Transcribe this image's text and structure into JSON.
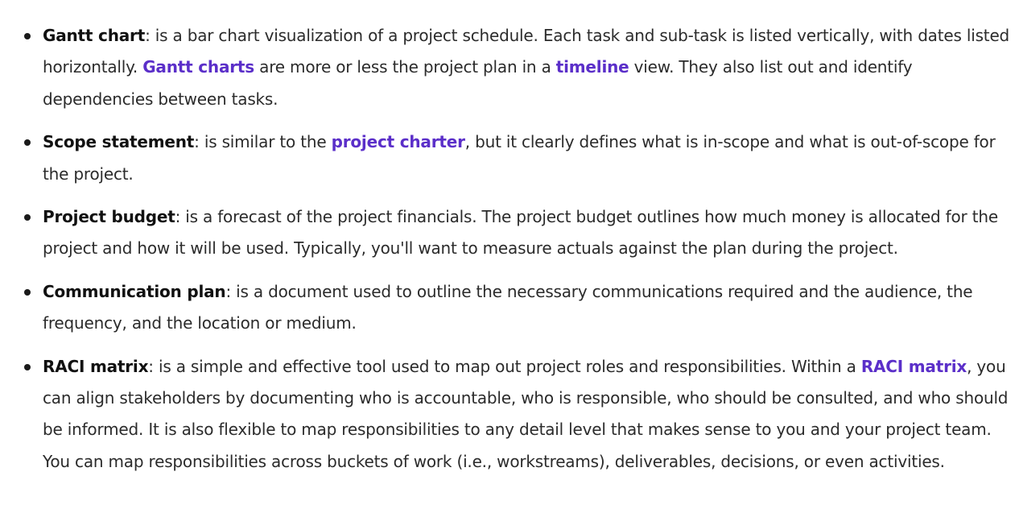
{
  "colors": {
    "text": "#2b2b2b",
    "term": "#111111",
    "link": "#5b2fc9"
  },
  "items": [
    {
      "term": "Gantt chart",
      "t1": ":  is a bar chart visualization of a project schedule. Each task and sub-task is listed vertically, with dates listed horizontally. ",
      "link1": "Gantt charts",
      "t2": " are more or less the project plan in a ",
      "link2": "timeline",
      "t3": " view. They also list out and identify dependencies between tasks."
    },
    {
      "term": "Scope statement",
      "t1": ": is similar to the ",
      "link1": "project charter",
      "t2": ", but it clearly defines what is in-scope and what is out-of-scope for the project."
    },
    {
      "term": "Project budget",
      "t1": ": is a forecast of the project financials. The project budget outlines how much money is allocated for the project and how it will be used. Typically, you'll want to measure actuals against the plan during the project."
    },
    {
      "term": "Communication plan",
      "t1": ": is a document used to outline the necessary communications required and the audience, the frequency, and the location or medium."
    },
    {
      "term": "RACI matrix",
      "t1": ": is a simple and effective tool used to map out project roles and responsibilities. Within a ",
      "link1": "RACI matrix",
      "t2": ", you can align stakeholders by documenting who is accountable, who is responsible, who should be consulted, and who should be informed. It is also flexible to map responsibilities to any detail level that makes sense to you and your project team. You can map responsibilities across buckets of work (i.e., workstreams), deliverables, decisions, or even activities."
    }
  ]
}
